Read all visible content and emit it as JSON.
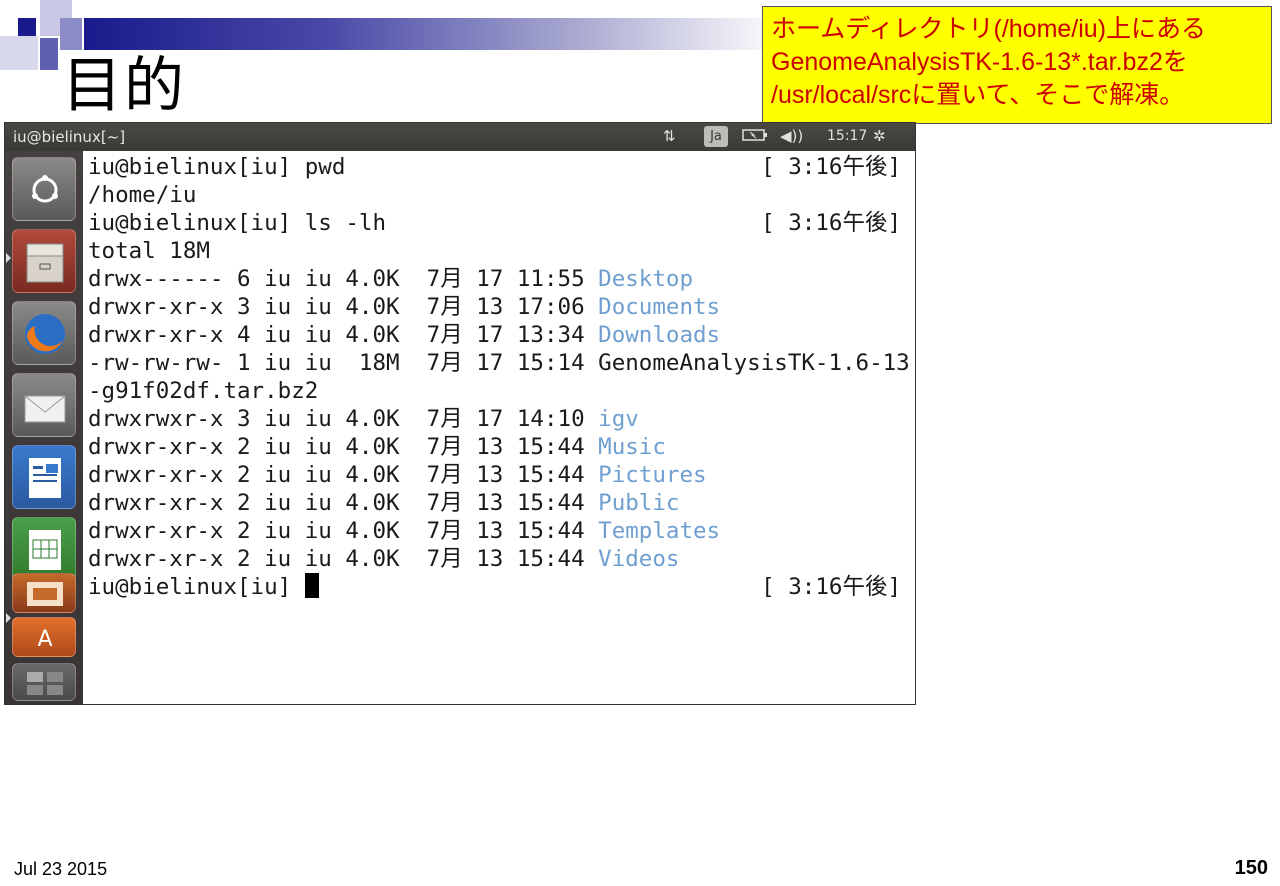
{
  "slide": {
    "title": "目的",
    "note_lines": [
      "ホームディレクトリ(/home/iu)上にある",
      "GenomeAnalysisTK-1.6-13*.tar.bz2を",
      "/usr/local/srcに置いて、そこで解凍。"
    ],
    "date": "Jul 23 2015",
    "page": "150"
  },
  "window": {
    "title": "iu@bielinux[~]",
    "indicators": {
      "network_icon": "updown-arrows-icon",
      "keyboard_label": "Ja",
      "battery_icon": "battery-icon",
      "volume_icon": "speaker-icon",
      "clock": "15:17",
      "settings_icon": "gear-icon"
    }
  },
  "launcher": {
    "items": [
      {
        "name": "dash-home",
        "icon": "ubuntu-logo-icon"
      },
      {
        "name": "file-manager",
        "icon": "file-cabinet-icon"
      },
      {
        "name": "firefox",
        "icon": "firefox-icon"
      },
      {
        "name": "mail",
        "icon": "envelope-icon"
      },
      {
        "name": "writer",
        "icon": "document-icon"
      },
      {
        "name": "calc",
        "icon": "spreadsheet-icon"
      },
      {
        "name": "impress",
        "icon": "presentation-icon"
      },
      {
        "name": "software-center",
        "icon": "shopping-bag-icon"
      },
      {
        "name": "workspaces",
        "icon": "workspace-icon"
      }
    ]
  },
  "terminal": {
    "lines": [
      {
        "text": "iu@bielinux[iu] pwd",
        "ts": "[ 3:16午後]"
      },
      {
        "text": "/home/iu"
      },
      {
        "text": "iu@bielinux[iu] ls -lh",
        "ts": "[ 3:16午後]"
      },
      {
        "text": "total 18M"
      },
      {
        "perm": "drwx------ 6 iu iu 4.0K  7月 17 11:55 ",
        "name": "Desktop",
        "dir": true
      },
      {
        "perm": "drwxr-xr-x 3 iu iu 4.0K  7月 13 17:06 ",
        "name": "Documents",
        "dir": true
      },
      {
        "perm": "drwxr-xr-x 4 iu iu 4.0K  7月 17 13:34 ",
        "name": "Downloads",
        "dir": true
      },
      {
        "perm": "-rw-rw-rw- 1 iu iu  18M  7月 17 15:14 ",
        "name": "GenomeAnalysisTK-1.6-13",
        "dir": false
      },
      {
        "text": "-g91f02df.tar.bz2"
      },
      {
        "perm": "drwxrwxr-x 3 iu iu 4.0K  7月 17 14:10 ",
        "name": "igv",
        "dir": true
      },
      {
        "perm": "drwxr-xr-x 2 iu iu 4.0K  7月 13 15:44 ",
        "name": "Music",
        "dir": true
      },
      {
        "perm": "drwxr-xr-x 2 iu iu 4.0K  7月 13 15:44 ",
        "name": "Pictures",
        "dir": true
      },
      {
        "perm": "drwxr-xr-x 2 iu iu 4.0K  7月 13 15:44 ",
        "name": "Public",
        "dir": true
      },
      {
        "perm": "drwxr-xr-x 2 iu iu 4.0K  7月 13 15:44 ",
        "name": "Templates",
        "dir": true
      },
      {
        "perm": "drwxr-xr-x 2 iu iu 4.0K  7月 13 15:44 ",
        "name": "Videos",
        "dir": true
      },
      {
        "text": "iu@bielinux[iu] ",
        "ts": "[ 3:16午後]",
        "cursor": true
      }
    ],
    "dir_color": "#6f9fd0"
  }
}
